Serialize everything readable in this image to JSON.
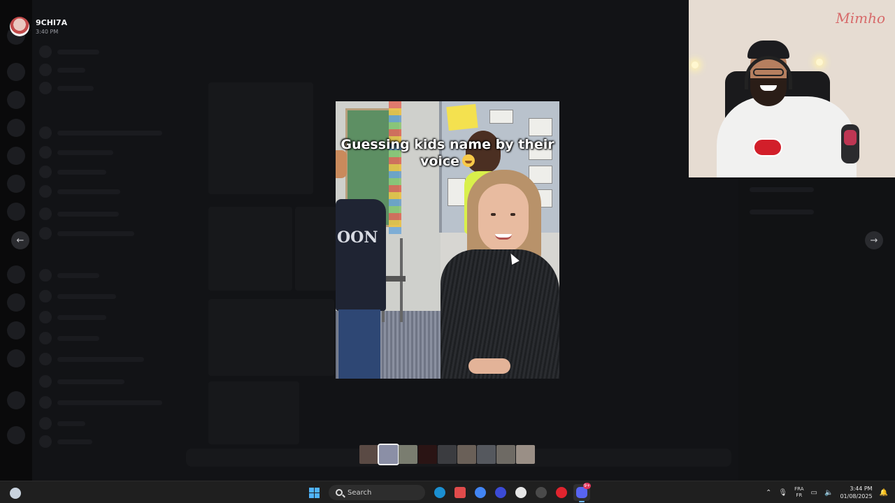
{
  "viewer": {
    "username": "9CHI7A",
    "timestamp": "3:40 PM"
  },
  "video": {
    "caption": "Guessing kids name by their voice",
    "shirt_text": "OON"
  },
  "webcam": {
    "signature": "Mimho"
  },
  "nav": {
    "prev_icon": "arrow-left-icon",
    "next_icon": "arrow-right-icon"
  },
  "thumbnails": [
    {
      "color": "#5a4a44",
      "active": false
    },
    {
      "color": "#8b8fa6",
      "active": true
    },
    {
      "color": "#7a7d70",
      "active": false
    },
    {
      "color": "#2a1414",
      "active": false
    },
    {
      "color": "#3b3c40",
      "active": false
    },
    {
      "color": "#6a6058",
      "active": false
    },
    {
      "color": "#55585e",
      "active": false
    },
    {
      "color": "#6e6a64",
      "active": false
    },
    {
      "color": "#9a8f86",
      "active": false
    }
  ],
  "taskbar": {
    "search_label": "Search",
    "language_primary": "FRA",
    "language_secondary": "FR",
    "time": "3:44 PM",
    "date": "01/08/2025",
    "discord_badge": "9+",
    "apps": [
      "steam-icon",
      "snipping-tool-icon",
      "chrome-icon",
      "vivaldi-icon",
      "chatgpt-icon",
      "obs-icon",
      "opera-icon",
      "discord-icon"
    ],
    "colors": {
      "steam": "#1b8fd1",
      "snip": "#e04b4b",
      "chrome": "#4285f4",
      "vivaldi": "#3b4bd6",
      "chatgpt": "#e6e6e6",
      "obs": "#4a4a4a",
      "opera": "#e0242e",
      "discord": "#5865f2"
    }
  }
}
